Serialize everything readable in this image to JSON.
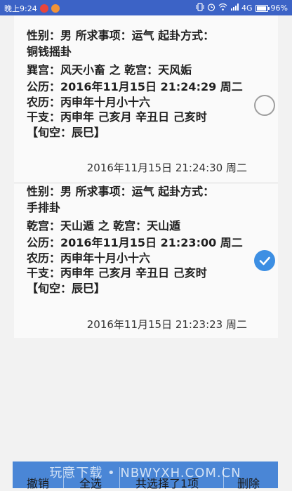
{
  "status_bar": {
    "time": "晚上9:24",
    "network": "4G",
    "battery": "96%",
    "battery_level": 0.96,
    "colors": {
      "background": "#3c63c6"
    },
    "icons": [
      "weibo-notification-icon",
      "app-notification-icon",
      "vibrate-icon",
      "alarm-icon",
      "wifi-icon",
      "signal-icon",
      "battery-icon"
    ]
  },
  "records": [
    {
      "lines": [
        "性别：男  所求事项：运气  起卦方式：",
        "铜钱摇卦",
        "巽宫：风天小畜 之 乾宫：天风姤",
        "公历：2016年11月15日 21:24:29 周二",
        "农历：丙申年十月小十六",
        "干支：丙申年  己亥月  辛丑日  己亥时",
        "【旬空：辰巳】"
      ],
      "saved_time": "2016年11月15日 21:24:30 周二",
      "selected": false
    },
    {
      "lines": [
        "性别：男  所求事项：运气  起卦方式：",
        "手排卦",
        "乾宫：天山遁 之 乾宫：天山遁",
        "公历：2016年11月15日 21:23:00 周二",
        "农历：丙申年十月小十六",
        "干支：丙申年  己亥月  辛丑日  己亥时",
        "【旬空：辰巳】"
      ],
      "saved_time": "2016年11月15日 21:23:23 周二",
      "selected": true
    }
  ],
  "bottom_bar": {
    "cancel": "撤销",
    "select_all": "全选",
    "selected_count": "共选择了1项",
    "delete": "删除",
    "watermark": "玩意下载 • NBWYXH.COM.CN",
    "colors": {
      "background": "#4a86d6",
      "check": "#3d8fe3"
    }
  }
}
